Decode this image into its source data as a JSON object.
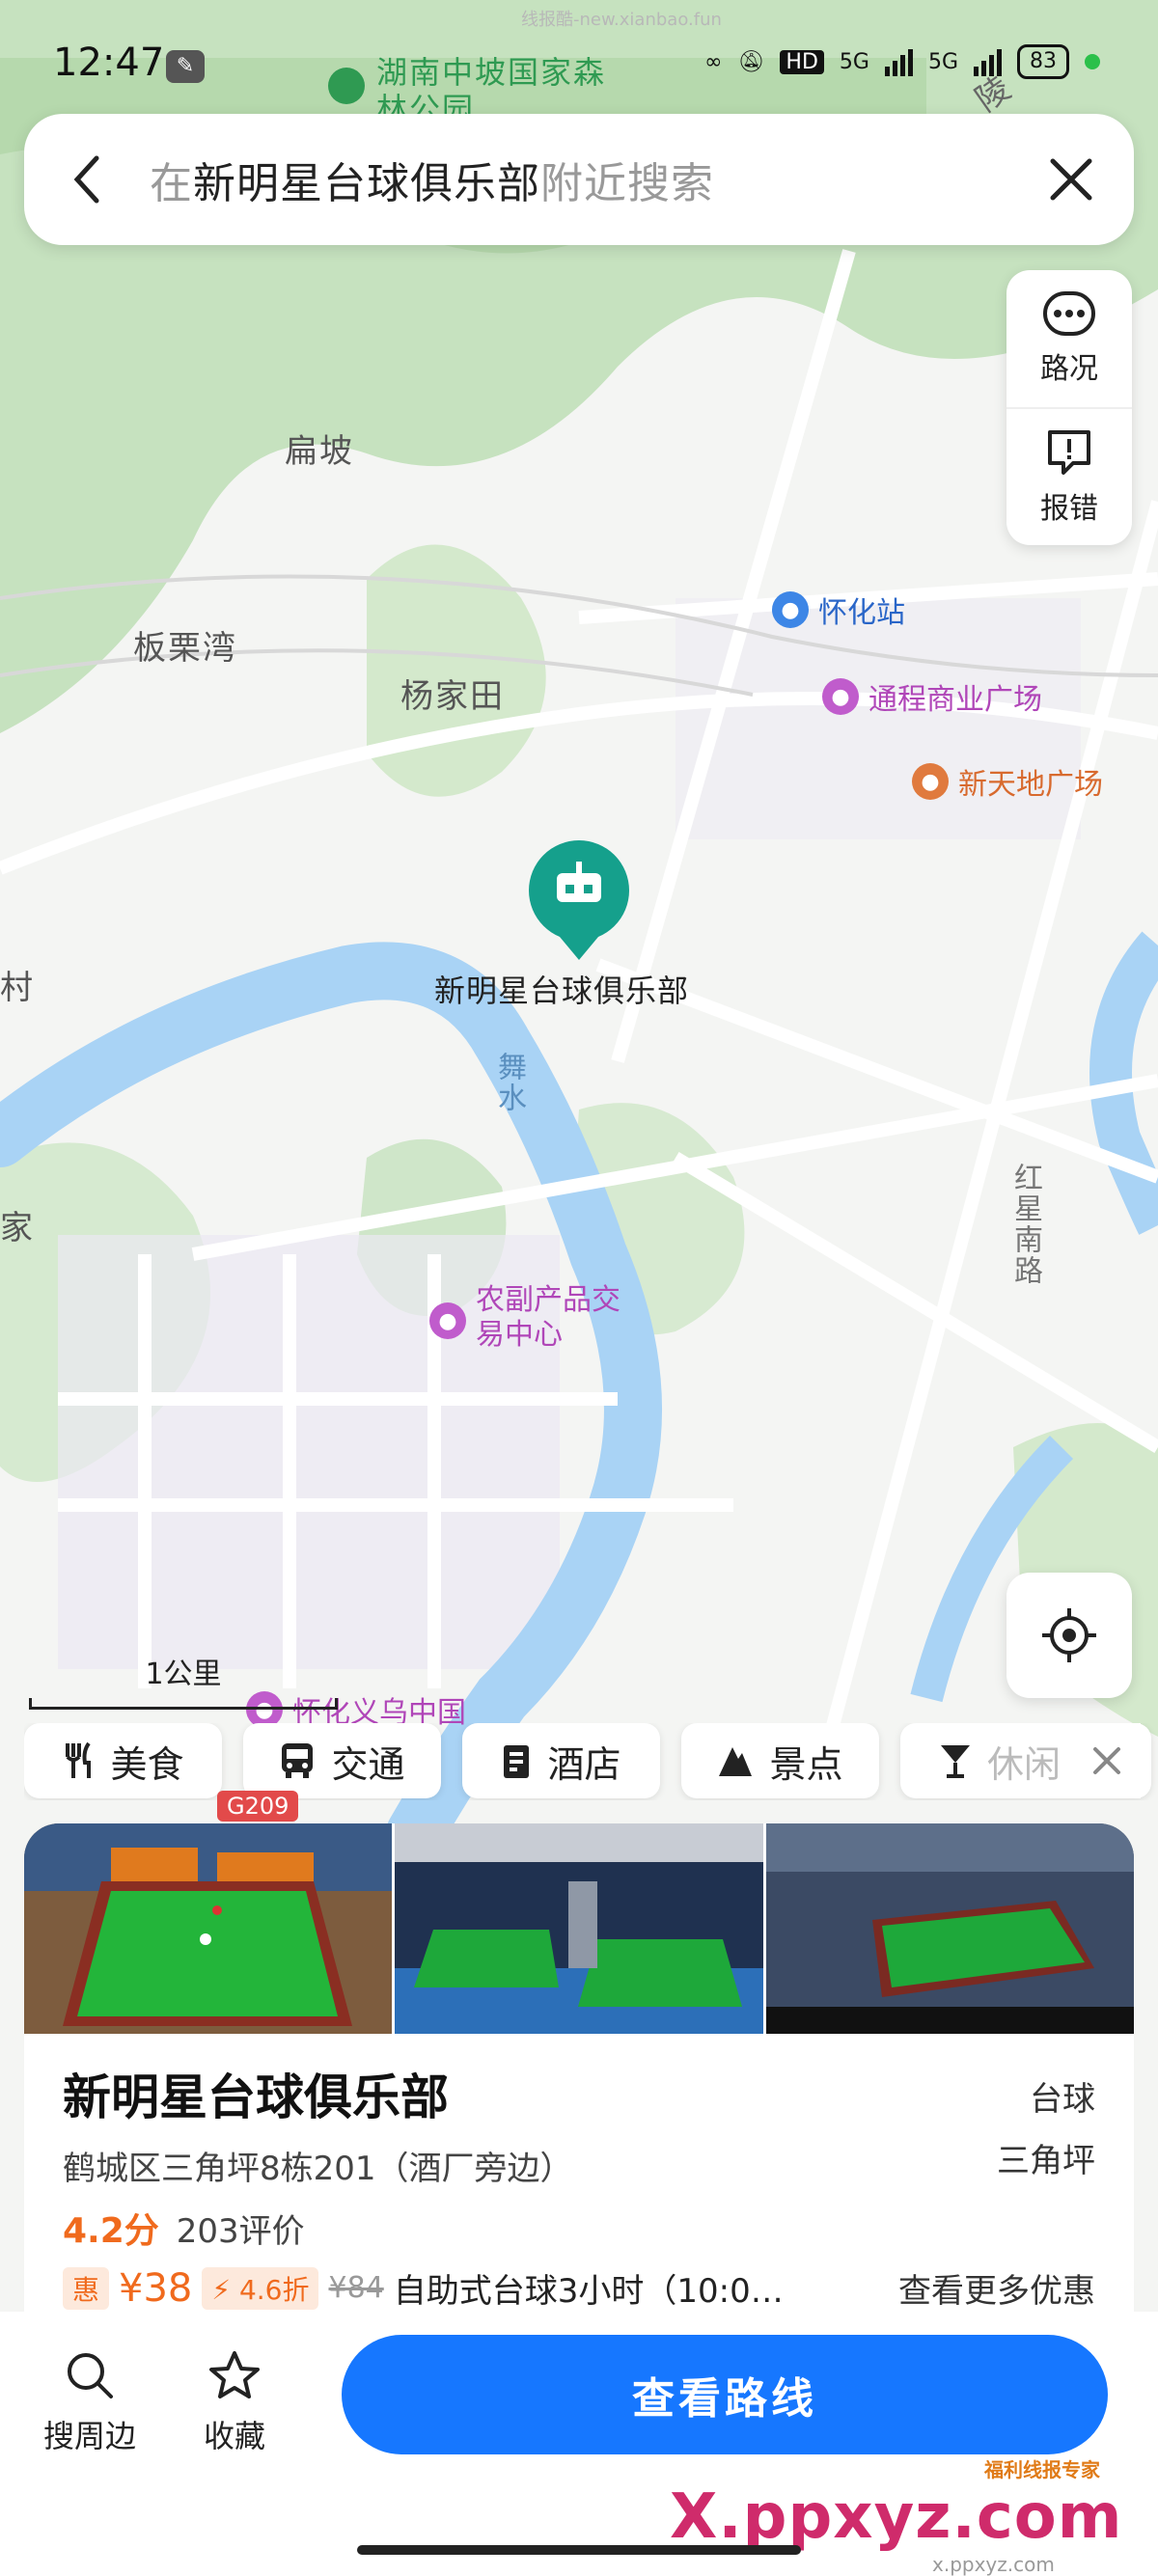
{
  "status_bar": {
    "time": "12:47",
    "network_hd": "HD",
    "network_5g_1": "5G",
    "network_5g_2": "5G",
    "battery": "83",
    "watermark": "线报酷-new.xianbao.fun"
  },
  "search": {
    "prefix": "在",
    "place": "新明星台球俱乐部",
    "suffix": "附近搜索"
  },
  "map": {
    "labels": {
      "park": "湖南中坡国家森林公园",
      "bianpo": "扁坡",
      "banliwan": "板栗湾",
      "yangjiatian": "杨家田",
      "huaihua_station": "怀化站",
      "tongcheng": "通程商业广场",
      "xintiandi": "新天地广场",
      "selected_poi": "新明星台球俱乐部",
      "river": "舞水",
      "hongxing_road": "红星南路",
      "nongfu": "农副产品交易中心",
      "yiwu": "怀化义乌中国",
      "cun": "村",
      "jia": "家",
      "ling": "陵"
    },
    "scale": "1公里"
  },
  "tools": {
    "traffic": "路况",
    "report": "报错"
  },
  "categories": [
    {
      "label": "美食",
      "icon": "fork-knife-icon"
    },
    {
      "label": "交通",
      "icon": "bus-icon"
    },
    {
      "label": "酒店",
      "icon": "hotel-icon"
    },
    {
      "label": "景点",
      "icon": "mountain-icon"
    },
    {
      "label": "休闲",
      "icon": "cocktail-icon"
    }
  ],
  "poi": {
    "road_badge": "G209",
    "name": "新明星台球俱乐部",
    "category": "台球",
    "address": "鹤城区三角坪8栋201（酒厂旁边）",
    "district": "三角坪",
    "rating": "4.2分",
    "reviews": "203评价",
    "deal_tag": "惠",
    "price": "¥38",
    "discount": "4.6折",
    "original_price": "¥84",
    "deal_desc": "自助式台球3小时（10:0…",
    "more_deals": "查看更多优惠"
  },
  "actions": {
    "nearby": "搜周边",
    "favorite": "收藏",
    "route": "查看路线"
  },
  "branding": {
    "logo": "X.ppxyz.com",
    "small": "福利线报专家",
    "url": "x.ppxyz.com"
  },
  "colors": {
    "accent": "#1677ff",
    "price": "#f06a1d",
    "river": "#a9d3f5",
    "green": "#cfe6c9",
    "poi_teal": "#15a08c"
  }
}
